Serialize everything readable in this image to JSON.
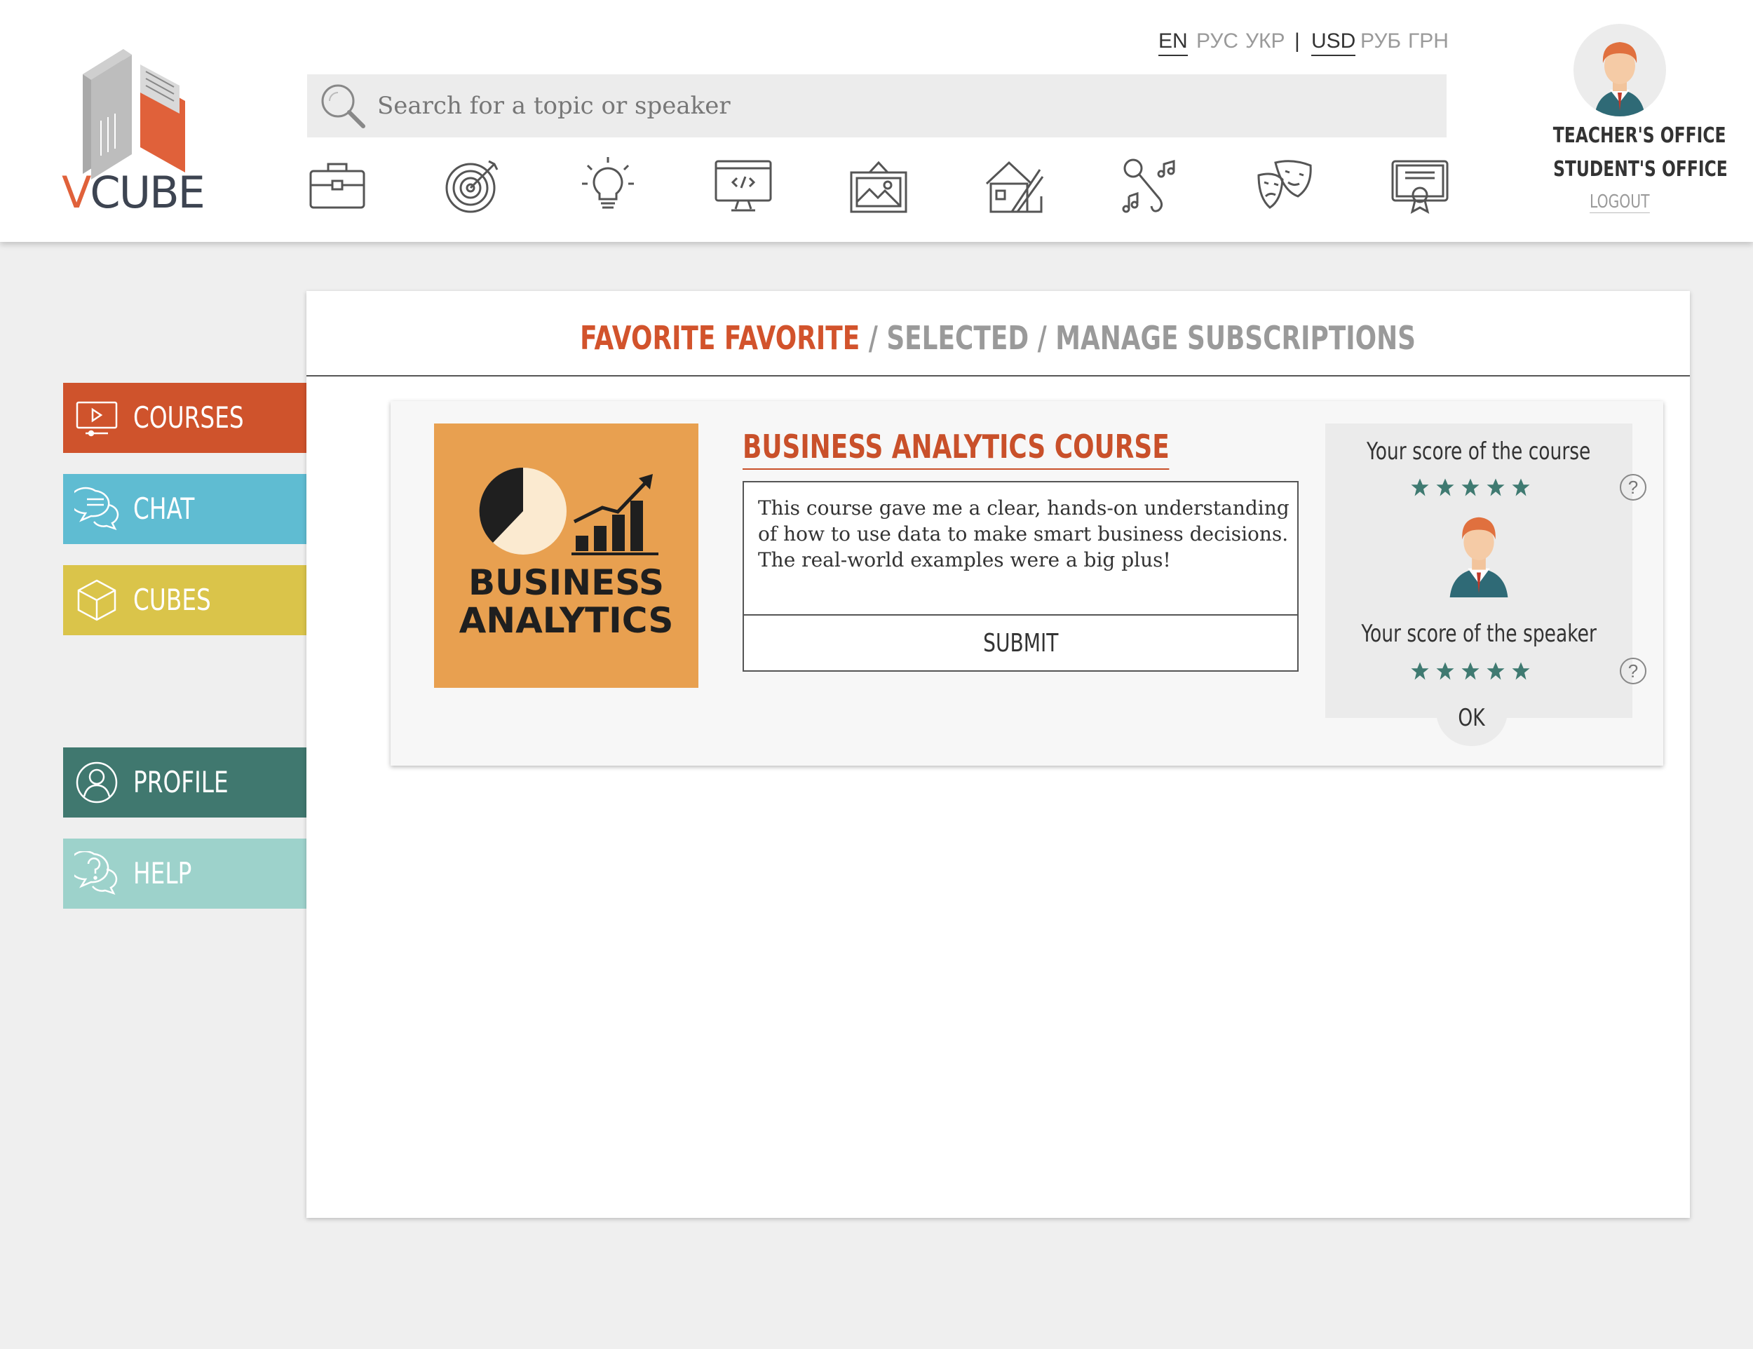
{
  "brand": {
    "logo_v": "V",
    "logo_rest": "CUBE",
    "accent": "#e0613a"
  },
  "header": {
    "languages": [
      "EN",
      "РУС",
      "УКР"
    ],
    "active_language": "EN",
    "divider": "|",
    "currencies": [
      "USD",
      "РУБ",
      "ГРН"
    ],
    "active_currency": "USD",
    "search_placeholder": "Search for a topic or speaker",
    "categories": [
      "briefcase-icon",
      "target-icon",
      "lightbulb-icon",
      "code-monitor-icon",
      "painting-icon",
      "architecture-icon",
      "music-icon",
      "theater-masks-icon",
      "certificate-icon"
    ],
    "teacher_office": "TEACHER'S OFFICE",
    "student_office": "STUDENT'S OFFICE",
    "logout": "LOGOUT"
  },
  "sidebar": {
    "items": [
      {
        "label": "COURSES",
        "icon": "video-monitor-icon",
        "color": "#cf532c",
        "active": true
      },
      {
        "label": "CHAT",
        "icon": "chat-bubbles-icon",
        "color": "#5fbcd2"
      },
      {
        "label": "CUBES",
        "icon": "cube-icon",
        "color": "#dac44a"
      },
      {
        "label": "PROFILE",
        "icon": "user-icon",
        "color": "#40786f"
      },
      {
        "label": "HELP",
        "icon": "question-bubble-icon",
        "color": "#9dd2cb"
      }
    ]
  },
  "tabs": {
    "active": "FAVORITE FAVORITE",
    "separator": "/",
    "selected": "SELECTED",
    "manage": "MANAGE SUBSCRIPTIONS"
  },
  "course": {
    "image_text_line1": "BUSINESS",
    "image_text_line2": "ANALYTICS",
    "title": "BUSINESS ANALYTICS COURSE",
    "review": "This course gave me a clear, hands-on understanding of how to use data to make smart business decisions. The real-world examples were a big plus!",
    "submit": "SUBMIT"
  },
  "scores": {
    "course_label": "Your score of the course",
    "course_stars": 5,
    "speaker_label": "Your score of the speaker",
    "speaker_stars": 5,
    "help": "?",
    "ok": "OK",
    "star_color": "#3f7a71"
  }
}
